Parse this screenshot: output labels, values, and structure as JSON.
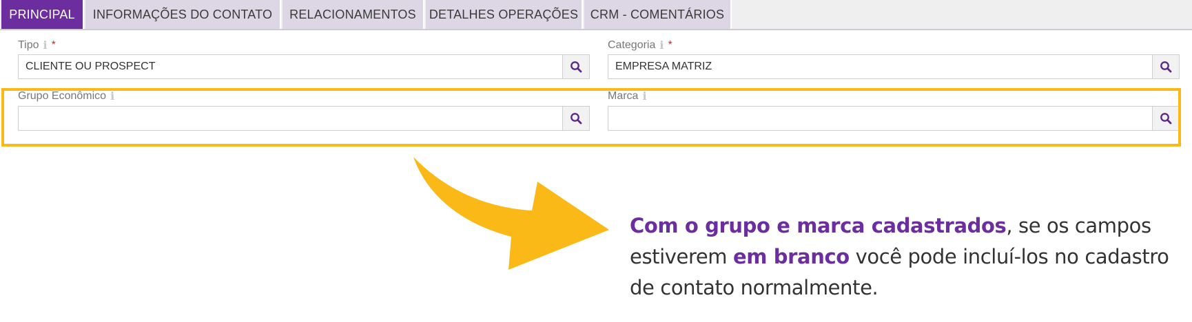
{
  "tabs": [
    {
      "label": "PRINCIPAL",
      "active": true
    },
    {
      "label": "INFORMAÇÕES DO CONTATO",
      "active": false
    },
    {
      "label": "RELACIONAMENTOS",
      "active": false
    },
    {
      "label": "DETALHES OPERAÇÕES",
      "active": false
    },
    {
      "label": "CRM - COMENTÁRIOS",
      "active": false
    }
  ],
  "form": {
    "tipo": {
      "label": "Tipo",
      "info": "i",
      "required": "*",
      "value": "CLIENTE OU PROSPECT"
    },
    "categoria": {
      "label": "Categoria",
      "info": "i",
      "required": "*",
      "value": "EMPRESA MATRIZ"
    },
    "grupo": {
      "label": "Grupo Econômico",
      "info": "i",
      "value": ""
    },
    "marca": {
      "label": "Marca",
      "info": "i",
      "value": ""
    }
  },
  "icons": {
    "lookup": "search-icon",
    "info": "info-icon",
    "arrow": "curved-arrow-icon"
  },
  "callout": {
    "highlight1": "Com o grupo e marca cadastrados",
    "text1": ", se os campos estiverem ",
    "highlight2": "em branco",
    "text2": " você pode incluí-los no cadastro de contato normalmente."
  },
  "colors": {
    "accent": "#6c2e9e",
    "tab_inactive": "#ddd6e5",
    "highlight": "#fbb917",
    "required": "#d12a2a"
  }
}
